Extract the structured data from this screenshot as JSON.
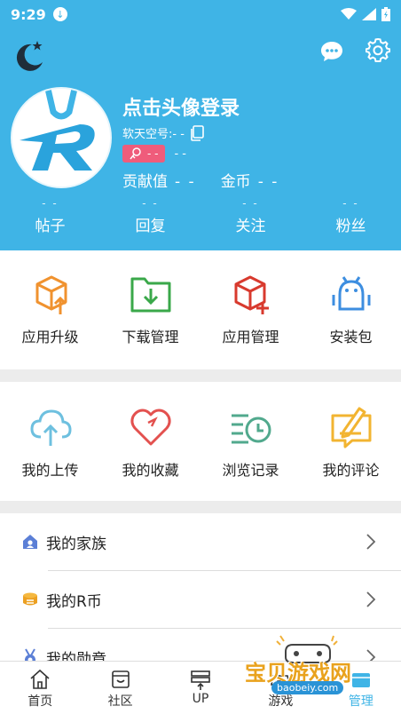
{
  "status_bar": {
    "time": "9:29"
  },
  "header": {
    "login_title": "点击头像登录",
    "uid_label": "软天空号:- -",
    "level_value": "- -",
    "level_extra": "- -",
    "contribution_label": "贡献值",
    "contribution_value": "- -",
    "coins_label": "金币",
    "coins_value": "- -",
    "counters": [
      {
        "value": "- -",
        "label": "帖子"
      },
      {
        "value": "- -",
        "label": "回复"
      },
      {
        "value": "- -",
        "label": "关注"
      },
      {
        "value": "- -",
        "label": "粉丝"
      }
    ]
  },
  "grid1": [
    {
      "label": "应用升级",
      "icon": "box-upgrade-icon",
      "color": "#f0922f"
    },
    {
      "label": "下载管理",
      "icon": "folder-download-icon",
      "color": "#3aa84a"
    },
    {
      "label": "应用管理",
      "icon": "box-add-icon",
      "color": "#d83a2e"
    },
    {
      "label": "安装包",
      "icon": "android-icon",
      "color": "#3d8ee0"
    }
  ],
  "grid2": [
    {
      "label": "我的上传",
      "icon": "cloud-upload-icon",
      "color": "#6ec0df"
    },
    {
      "label": "我的收藏",
      "icon": "heart-icon",
      "color": "#e3514f"
    },
    {
      "label": "浏览记录",
      "icon": "history-icon",
      "color": "#51a98d"
    },
    {
      "label": "我的评论",
      "icon": "comment-edit-icon",
      "color": "#f2b431"
    }
  ],
  "list": [
    {
      "label": "我的家族",
      "icon": "family-icon"
    },
    {
      "label": "我的R币",
      "icon": "r-coin-icon"
    },
    {
      "label": "我的勋章",
      "icon": "medal-icon"
    }
  ],
  "nav": [
    {
      "label": "首页",
      "icon": "home-icon"
    },
    {
      "label": "社区",
      "icon": "community-icon"
    },
    {
      "label": "UP",
      "icon": "up-icon"
    },
    {
      "label": "游戏",
      "icon": "game-icon"
    },
    {
      "label": "管理",
      "icon": "manage-icon",
      "active": true
    }
  ],
  "watermark": {
    "text": "宝贝游戏网",
    "url": "baobeiy.com"
  },
  "colors": {
    "brand": "#3fb4e6",
    "level_badge": "#ef5c7b"
  }
}
